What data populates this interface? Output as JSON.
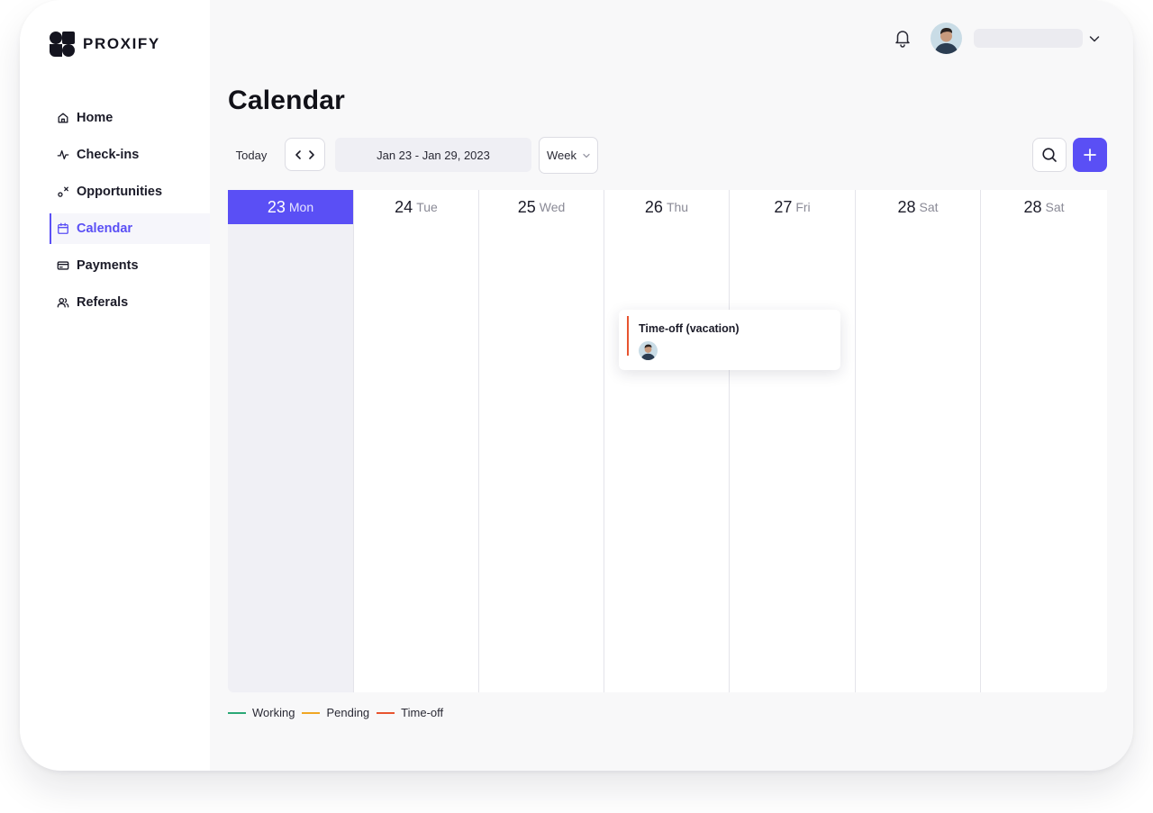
{
  "brand": {
    "name": "PROXIFY"
  },
  "sidebar": {
    "items": [
      {
        "label": "Home",
        "icon": "home-icon",
        "active": false
      },
      {
        "label": "Check-ins",
        "icon": "activity-icon",
        "active": false
      },
      {
        "label": "Opportunities",
        "icon": "opportunities-icon",
        "active": false
      },
      {
        "label": "Calendar",
        "icon": "calendar-icon",
        "active": true
      },
      {
        "label": "Payments",
        "icon": "payments-icon",
        "active": false
      },
      {
        "label": "Referals",
        "icon": "users-icon",
        "active": false
      }
    ]
  },
  "header": {
    "bell_icon": "bell-icon",
    "avatar_icon": "avatar",
    "menu_icon": "chevron-down-icon"
  },
  "page": {
    "title": "Calendar"
  },
  "toolbar": {
    "today_label": "Today",
    "date_range": "Jan 23 - Jan 29, 2023",
    "view": "Week",
    "search_icon": "search-icon",
    "add_icon": "plus-icon"
  },
  "calendar": {
    "days": [
      {
        "num": "23",
        "name": "Mon",
        "today": true
      },
      {
        "num": "24",
        "name": "Tue",
        "today": false
      },
      {
        "num": "25",
        "name": "Wed",
        "today": false
      },
      {
        "num": "26",
        "name": "Thu",
        "today": false
      },
      {
        "num": "27",
        "name": "Fri",
        "today": false
      },
      {
        "num": "28",
        "name": "Sat",
        "today": false
      },
      {
        "num": "28",
        "name": "Sat",
        "today": false
      }
    ],
    "events": [
      {
        "title": "Time-off (vacation)",
        "status": "Time-off"
      }
    ]
  },
  "legend": [
    {
      "label": "Working",
      "color": "#2aa876"
    },
    {
      "label": "Pending",
      "color": "#f0a623"
    },
    {
      "label": "Time-off",
      "color": "#e8542f"
    }
  ],
  "colors": {
    "accent": "#5a4ff5"
  }
}
